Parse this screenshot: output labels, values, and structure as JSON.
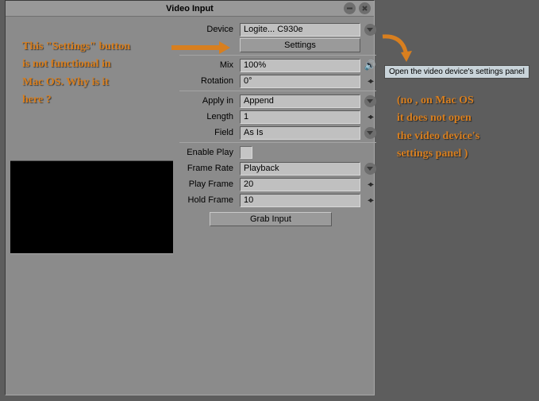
{
  "window": {
    "title": "Video Input"
  },
  "fields": {
    "device_label": "Device",
    "device_value": "Logite... C930e",
    "settings_button": "Settings",
    "mix_label": "Mix",
    "mix_value": "100%",
    "rotation_label": "Rotation",
    "rotation_value": "0°",
    "applyin_label": "Apply in",
    "applyin_value": "Append",
    "length_label": "Length",
    "length_value": "1",
    "field_label": "Field",
    "field_value": "As Is",
    "enableplay_label": "Enable Play",
    "framerate_label": "Frame Rate",
    "framerate_value": "Playback",
    "playframe_label": "Play Frame",
    "playframe_value": "20",
    "holdframe_label": "Hold Frame",
    "holdframe_value": "10",
    "grab_button": "Grab Input"
  },
  "tooltip": "Open the video device's settings panel",
  "annotations": {
    "left_line1": "This \"Settings\" button",
    "left_line2": "is not functional in",
    "left_line3": "Mac OS.  Why is it",
    "left_line4": "here ?",
    "right_line1": "(no , on Mac OS",
    "right_line2": " it does not open",
    "right_line3": "the video device's",
    "right_line4": "settings panel )"
  }
}
